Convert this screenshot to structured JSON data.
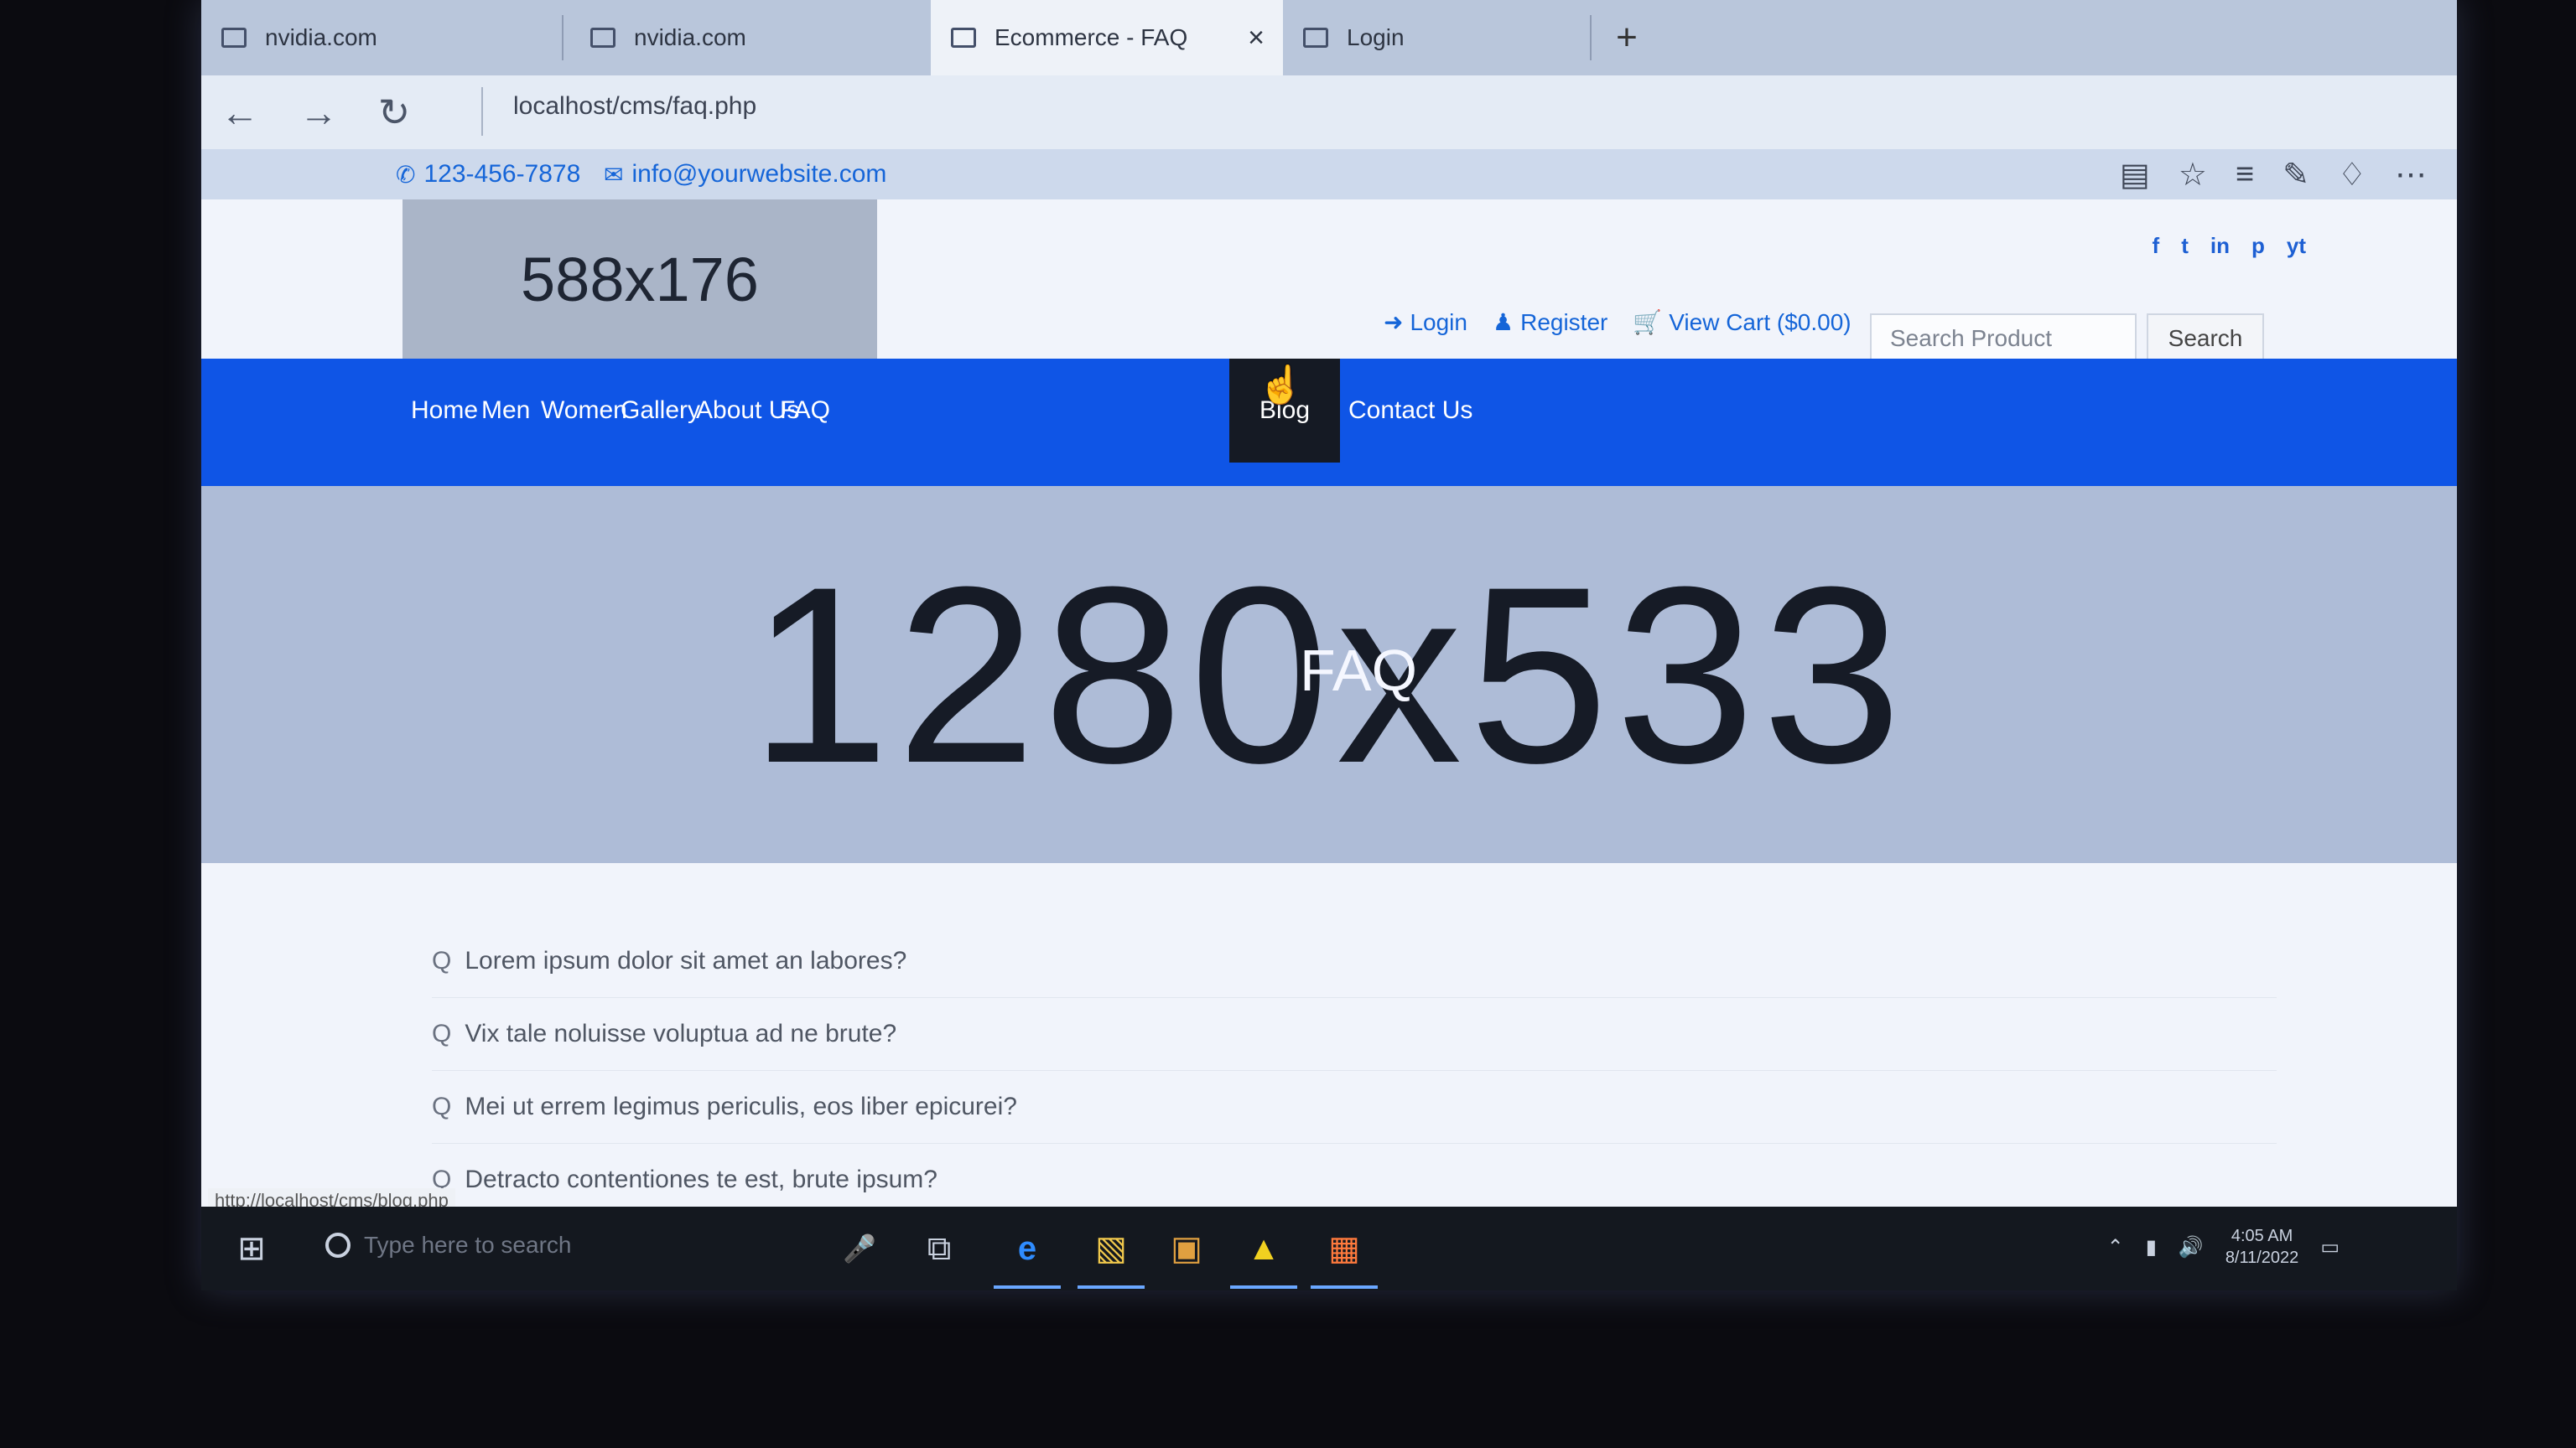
{
  "browser": {
    "tabs": [
      {
        "title": "nvidia.com",
        "active": false
      },
      {
        "title": "nvidia.com",
        "active": false
      },
      {
        "title": "Ecommerce - FAQ",
        "active": true
      },
      {
        "title": "Login",
        "active": false
      }
    ],
    "new_tab_label": "+",
    "close_label": "×",
    "url": "localhost/cms/faq.php",
    "status_url": "http://localhost/cms/blog.php"
  },
  "site": {
    "phone": "123-456-7878",
    "email": "info@yourwebsite.com",
    "logo_placeholder": "588x176",
    "social": [
      "f",
      "t",
      "in",
      "p",
      "yt"
    ],
    "user_actions": {
      "login": "Login",
      "register": "Register",
      "cart": "View Cart ($0.00)"
    },
    "search": {
      "placeholder": "Search Product",
      "button": "Search"
    },
    "nav": [
      "Home",
      "Men",
      "Women",
      "Gallery",
      "About Us",
      "FAQ",
      "Blog",
      "Contact Us"
    ],
    "nav_active": "Blog",
    "banner": {
      "size_text": "1280x533",
      "title": "FAQ"
    },
    "faq": [
      "Lorem ipsum dolor sit amet an labores?",
      "Vix tale noluisse voluptua ad ne brute?",
      "Mei ut errem legimus periculis, eos liber epicurei?",
      "Detracto contentiones te est, brute ipsum?"
    ],
    "faq_prefix": "Q"
  },
  "taskbar": {
    "search_placeholder": "Type here to search",
    "time": "4:05 AM",
    "date": "8/11/2022"
  },
  "colors": {
    "nav_bg": "#0f55e6",
    "nav_active_bg": "#151a24",
    "link": "#1565d8"
  }
}
